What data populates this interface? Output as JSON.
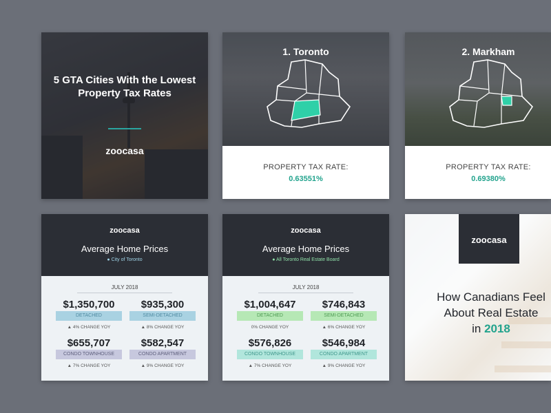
{
  "cover": {
    "title": "5 GTA Cities With the Lowest Property Tax Rates",
    "logo": "zoocasa"
  },
  "cities": [
    {
      "title": "1. Toronto",
      "label": "PROPERTY TAX RATE:",
      "rate": "0.63551%"
    },
    {
      "title": "2. Markham",
      "label": "PROPERTY TAX RATE:",
      "rate": "0.69380%"
    }
  ],
  "price_cards": [
    {
      "logo": "zoocasa",
      "title": "Average Home Prices",
      "subtitle": "● City of Toronto",
      "month": "JULY 2018",
      "cells": [
        {
          "value": "$1,350,700",
          "type": "DETACHED",
          "change": "▲ 4% CHANGE YOY"
        },
        {
          "value": "$935,300",
          "type": "SEMI-DETACHED",
          "change": "▲ 8% CHANGE YOY"
        },
        {
          "value": "$655,707",
          "type": "CONDO TOWNHOUSE",
          "change": "▲ 7% CHANGE YOY"
        },
        {
          "value": "$582,547",
          "type": "CONDO APARTMENT",
          "change": "▲ 9% CHANGE YOY"
        }
      ]
    },
    {
      "logo": "zoocasa",
      "title": "Average Home Prices",
      "subtitle": "● All Toronto Real Estate Board",
      "month": "JULY 2018",
      "cells": [
        {
          "value": "$1,004,647",
          "type": "DETACHED",
          "change": "0% CHANGE YOY"
        },
        {
          "value": "$746,843",
          "type": "SEMI-DETACHED",
          "change": "▲ 6% CHANGE YOY"
        },
        {
          "value": "$576,826",
          "type": "CONDO TOWNHOUSE",
          "change": "▲ 7% CHANGE YOY"
        },
        {
          "value": "$546,984",
          "type": "CONDO APARTMENT",
          "change": "▲ 9% CHANGE YOY"
        }
      ]
    }
  ],
  "survey": {
    "logo": "zoocasa",
    "line1": "How Canadians Feel",
    "line2": "About Real Estate",
    "line3_prefix": "in",
    "year": "2018"
  },
  "colors": {
    "background": "#6b6f78",
    "accent": "#22a38d",
    "dark_header": "#2b2e35"
  }
}
